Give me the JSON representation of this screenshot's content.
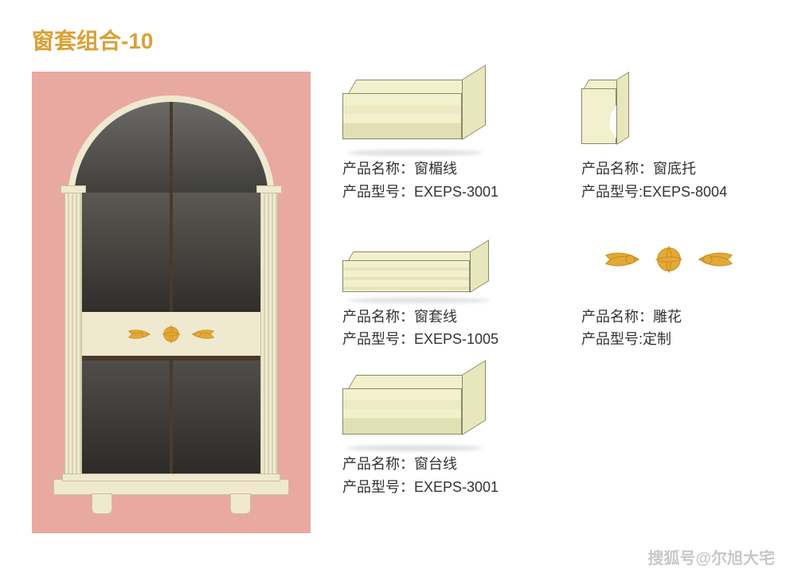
{
  "title": "窗套组合-10",
  "products": {
    "lintel": {
      "name_label": "产品名称：",
      "name_value": "窗楣线",
      "model_label": "产品型号：",
      "model_value": "EXEPS-3001"
    },
    "corbel": {
      "name_label": "产品名称：",
      "name_value": "窗底托",
      "model_label": "产品型号:",
      "model_value": "EXEPS-8004"
    },
    "casing": {
      "name_label": "产品名称：",
      "name_value": "窗套线",
      "model_label": "产品型号：",
      "model_value": "EXEPS-1005"
    },
    "carving": {
      "name_label": "产品名称：",
      "name_value": "雕花",
      "model_label": "产品型号:",
      "model_value": "定制"
    },
    "sill": {
      "name_label": "产品名称：",
      "name_value": "窗台线",
      "model_label": "产品型号：",
      "model_value": "EXEPS-3001"
    }
  },
  "watermark": "搜狐号@尔旭大宅"
}
